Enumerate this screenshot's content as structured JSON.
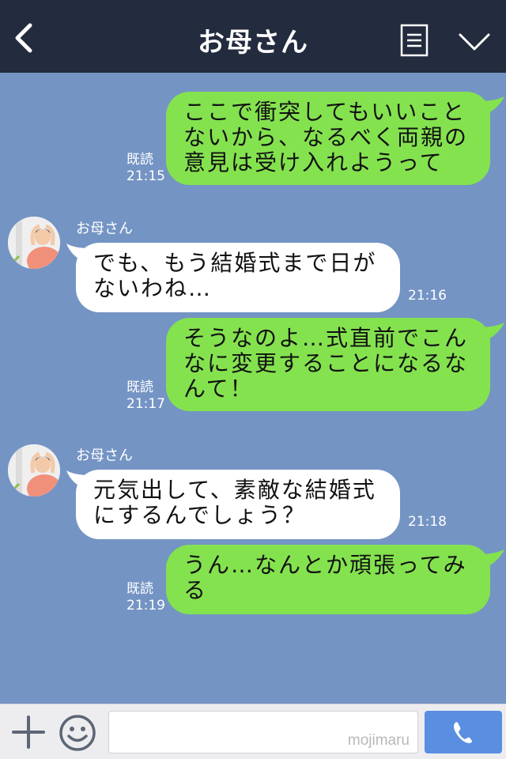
{
  "header": {
    "title": "お母さん"
  },
  "messages": [
    {
      "direction": "out",
      "lines": [
        "ここで衝突してもいいこと",
        "ないから、なるべく両親の",
        "意見は受け入れようって"
      ],
      "read_label": "既読",
      "time": "21:15"
    },
    {
      "direction": "in",
      "sender": "お母さん",
      "lines": [
        "でも、もう結婚式まで日が",
        "ないわね…"
      ],
      "time": "21:16"
    },
    {
      "direction": "out",
      "lines": [
        "そうなのよ…式直前でこん",
        "なに変更することになるな",
        "んて！"
      ],
      "read_label": "既読",
      "time": "21:17"
    },
    {
      "direction": "in",
      "sender": "お母さん",
      "lines": [
        "元気出して、素敵な結婚式",
        "にするんでしょう？"
      ],
      "time": "21:18"
    },
    {
      "direction": "out",
      "lines": [
        "うん…なんとか頑張ってみ",
        "る"
      ],
      "read_label": "既読",
      "time": "21:19"
    }
  ],
  "input": {
    "value": "",
    "watermark": "mojimaru"
  },
  "colors": {
    "header_bg": "#232b3e",
    "chat_bg": "#7494c4",
    "outgoing_bubble": "#84e24f",
    "incoming_bubble": "#ffffff",
    "call_button": "#5a8ee0"
  },
  "icons": {
    "back": "chevron-left-icon",
    "menu": "document-lines-icon",
    "collapse": "chevron-down-icon",
    "add": "plus-icon",
    "emoji": "smiley-icon",
    "call": "phone-icon"
  }
}
